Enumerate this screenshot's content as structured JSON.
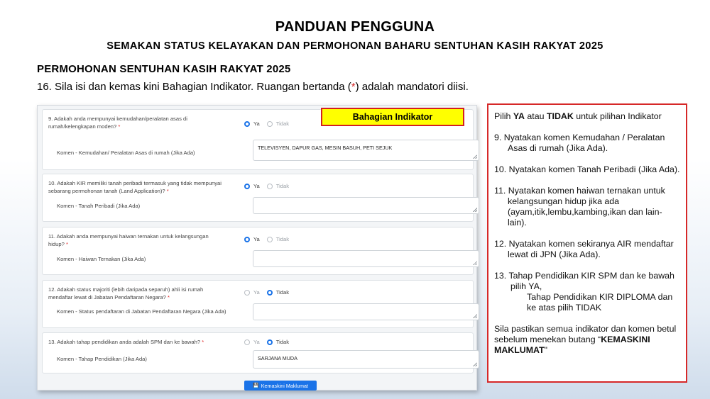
{
  "slide": {
    "title": "PANDUAN PENGGUNA",
    "subtitle": "SEMAKAN STATUS KELAYAKAN DAN PERMOHONAN BAHARU SENTUHAN  KASIH RAKYAT 2025",
    "section_heading": "PERMOHONAN SENTUHAN  KASIH RAKYAT 2025",
    "instruction_before": "16. Sila isi dan kemas kini Bahagian Indikator. Ruangan bertanda (",
    "instruction_star": "*",
    "instruction_after": ") adalah mandatori diisi."
  },
  "form": {
    "questions": [
      {
        "question": "9. Adakah anda mempunyai kemudahan/peralatan asas di rumah/kelengkapan moden?",
        "star": "*",
        "yes_label": "Ya",
        "no_label": "Tidak",
        "selected": "Ya",
        "comment_label": "Komen - Kemudahan/ Peralatan Asas di rumah (Jika Ada)",
        "comment_value": "TELEVISYEN, DAPUR GAS, MESIN BASUH, PETI SEJUK"
      },
      {
        "question": "10. Adakah KIR memiliki tanah peribadi termasuk yang tidak mempunyai sebarang permohonan tanah (Land Application)?",
        "star": "*",
        "yes_label": "Ya",
        "no_label": "Tidak",
        "selected": "Ya",
        "comment_label": "Komen - Tanah Peribadi (Jika Ada)",
        "comment_value": ""
      },
      {
        "question": "11. Adakah anda mempunyai haiwan ternakan untuk kelangsungan hidup?",
        "star": "*",
        "yes_label": "Ya",
        "no_label": "Tidak",
        "selected": "Ya",
        "comment_label": "Komen - Haiwan Ternakan (Jika Ada)",
        "comment_value": ""
      },
      {
        "question": "12. Adakah status majoriti (lebih daripada separuh) ahli isi rumah mendaftar lewat di Jabatan Pendaftaran Negara?",
        "star": "*",
        "yes_label": "Ya",
        "no_label": "Tidak",
        "selected": "Tidak",
        "comment_label": "Komen - Status pendaftaran di Jabatan Pendaftaran Negara (Jika Ada)",
        "comment_value": ""
      },
      {
        "question": "13. Adakah tahap pendidikan anda adalah SPM dan ke bawah?",
        "star": "*",
        "yes_label": "Ya",
        "no_label": "Tidak",
        "selected": "Tidak",
        "comment_label": "Komen - Tahap Pendidikan (Jika Ada)",
        "comment_value": "SARJANA MUDA"
      }
    ],
    "save_button": "Kemaskini Maklumat"
  },
  "callout": {
    "label": "Bahagian Indikator"
  },
  "panel": {
    "intro_pre": "Pilih ",
    "intro_ya": "YA",
    "intro_mid": " atau ",
    "intro_tidak": "TIDAK",
    "intro_post": " untuk pilihan Indikator",
    "item9": "9.  Nyatakan komen Kemudahan / Peralatan Asas di rumah (Jika Ada).",
    "item10": "10.  Nyatakan komen Tanah Peribadi (Jika Ada).",
    "item11": "11.  Nyatakan komen haiwan ternakan untuk kelangsungan hidup jika ada (ayam,itik,lembu,kambing,ikan dan lain-lain).",
    "item12": "12.  Nyatakan komen sekiranya AIR mendaftar lewat di JPN (Jika Ada).",
    "item13_line1": "13.  Tahap Pendidikan KIR SPM dan ke bawah pilih YA,",
    "item13_line2": "Tahap Pendidikan KIR DIPLOMA dan ke atas pilih TIDAK",
    "closing": "Sila pastikan semua indikator dan komen betul sebelum menekan butang ",
    "closing_quote_open": "“",
    "closing_bold": "KEMASKINI MAKLUMAT",
    "closing_quote_close": "\""
  }
}
